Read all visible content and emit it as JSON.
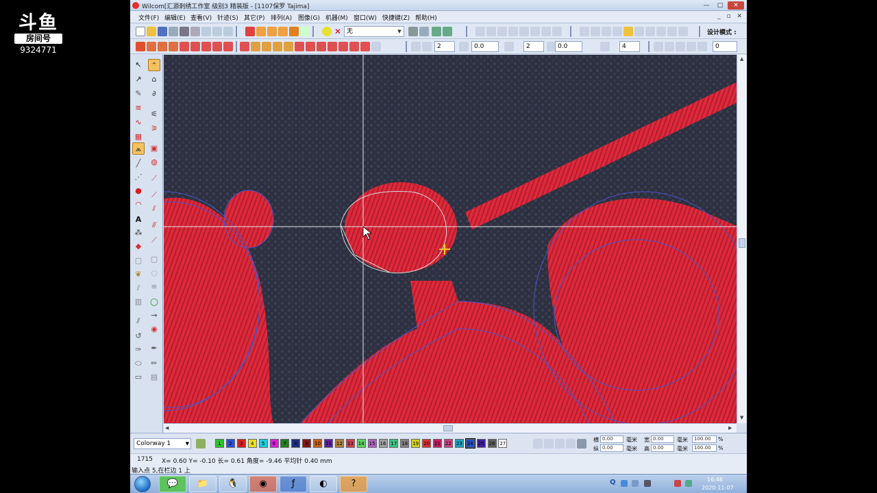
{
  "watermark": {
    "logo": "斗鱼",
    "room_label": "房间号",
    "room_number": "9324771"
  },
  "window": {
    "title": "Wilcom[汇源刺绣工作室  级别3 精装版 - [1107保罗        Tajima]",
    "min": "—",
    "max": "□",
    "close": "✕"
  },
  "menu": {
    "items": [
      "文件(F)",
      "编辑(E)",
      "查看(V)",
      "针迹(S)",
      "其它(P)",
      "排列(A)",
      "图像(G)",
      "机器(M)",
      "窗口(W)",
      "快捷键(Z)",
      "帮助(H)"
    ],
    "doc_controls": "_ ▫ ✕"
  },
  "toolbar": {
    "fabric_value": "无",
    "design_mode_label": "设计模式 :",
    "field1": "2",
    "field2": "0.0",
    "field3": "2",
    "field4": "0.0",
    "field5": "4",
    "field6": "0"
  },
  "colorway": {
    "selected": "Colorway 1",
    "chips": [
      "1",
      "2",
      "3",
      "4",
      "5",
      "6",
      "7",
      "8",
      "9",
      "10",
      "11",
      "12",
      "13",
      "14",
      "15",
      "16",
      "17",
      "18",
      "19",
      "20",
      "21",
      "22",
      "23",
      "24",
      "25",
      "26",
      "27"
    ],
    "chip_colors": [
      "#2fbf2f",
      "#2f4fd8",
      "#d82020",
      "#e8e020",
      "#20c8d8",
      "#d820d8",
      "#208020",
      "#203080",
      "#801818",
      "#c86020",
      "#6020a0",
      "#b08040",
      "#d04050",
      "#60d060",
      "#b060c0",
      "#a0a0a0",
      "#40c080",
      "#808080",
      "#d0d020",
      "#e03030",
      "#c02060",
      "#d04080",
      "#20a0c0",
      "#2050d0",
      "#4020a0",
      "#606060",
      "#ffffff"
    ],
    "selected_chip": "24"
  },
  "props": {
    "w_label": "宽",
    "h_label": "高",
    "x_label": "横",
    "y_label": "纵",
    "x_value": "0.00",
    "y_value": "0.00",
    "w_value": "0.00",
    "h_value": "0.00",
    "unit": "毫米",
    "scale_x": "100.00",
    "scale_y": "100.00",
    "pct": "%"
  },
  "status": {
    "stitch_count": "1715",
    "coords": "X=  0.60 Y=  -0.10 长=   0.61 角度=  -9.46  平均针  0.40 mm",
    "hint": "输入点 5,在栏边 1 上"
  },
  "taskbar": {
    "tray_q": "Q",
    "time": "16:46",
    "date": "2020-11-07"
  }
}
